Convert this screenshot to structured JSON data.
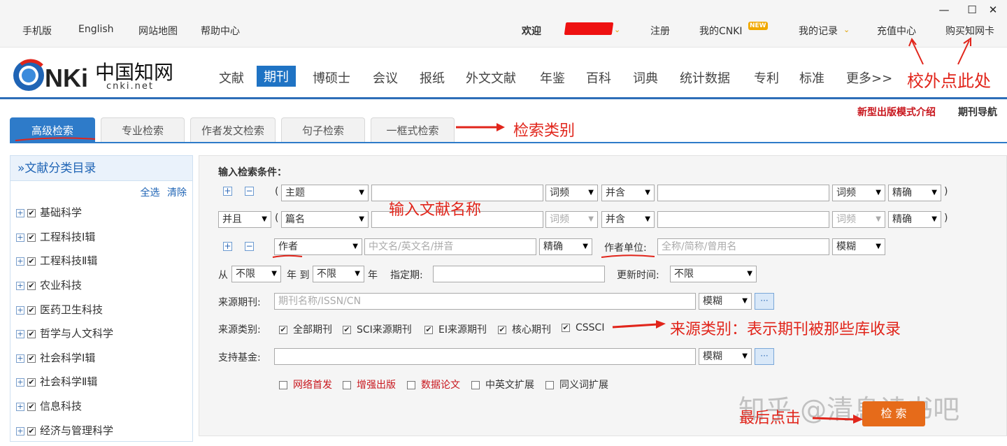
{
  "window": {
    "minimize": "—",
    "maximize": "☐",
    "close": "✕"
  },
  "topbar": {
    "links": [
      "手机版",
      "English",
      "网站地图",
      "帮助中心"
    ],
    "welcome": "欢迎",
    "register": "注册",
    "my_cnki": "我的CNKI",
    "new_badge": "NEW",
    "my_records": "我的记录",
    "recharge": "充值中心",
    "buy_card": "购买知网卡"
  },
  "logo": {
    "text": "CNKI",
    "cn": "中国知网",
    "domain": "cnki.net"
  },
  "nav": [
    "文献",
    "期刊",
    "博硕士",
    "会议",
    "报纸",
    "外文文献",
    "年鉴",
    "百科",
    "词典",
    "统计数据",
    "专利",
    "标准",
    "更多>>"
  ],
  "nav_active": "期刊",
  "right_links": {
    "new_mode": "新型出版模式介绍",
    "journal_nav": "期刊导航"
  },
  "tabs": [
    "高级检索",
    "专业检索",
    "作者发文检索",
    "句子检索",
    "一框式检索"
  ],
  "sidebar": {
    "title": "»文献分类目录",
    "select_all": "全选",
    "clear": "清除",
    "items": [
      "基础科学",
      "工程科技Ⅰ辑",
      "工程科技Ⅱ辑",
      "农业科技",
      "医药卫生科技",
      "哲学与人文科学",
      "社会科学Ⅰ辑",
      "社会科学Ⅱ辑",
      "信息科技",
      "经济与管理科学"
    ]
  },
  "form": {
    "heading": "输入检索条件：",
    "row1": {
      "open": "(",
      "field": "主题",
      "freq": "词频",
      "rel": "并含",
      "freq2": "词频",
      "match": "精确",
      "close": ")"
    },
    "row2": {
      "logic": "并且",
      "open": "(",
      "field": "篇名",
      "freq": "词频",
      "rel": "并含",
      "freq2": "词频",
      "match": "精确",
      "close": ")"
    },
    "row3": {
      "field": "作者",
      "name_placeholder": "中文名/英文名/拼音",
      "match": "精确",
      "affil_label": "作者单位:",
      "affil_placeholder": "全称/简称/曾用名",
      "affil_match": "模糊"
    },
    "date": {
      "from": "从",
      "from_val": "不限",
      "year_to": "年 到",
      "to_val": "不限",
      "year": "年",
      "period_label": "指定期:",
      "update_label": "更新时间:",
      "update_val": "不限"
    },
    "source": {
      "label": "来源期刊:",
      "placeholder": "期刊名称/ISSN/CN",
      "match": "模糊",
      "dots": "···"
    },
    "source_type": {
      "label": "来源类别:",
      "options": [
        "全部期刊",
        "SCI来源期刊",
        "EI来源期刊",
        "核心期刊",
        "CSSCI"
      ]
    },
    "fund": {
      "label": "支持基金:",
      "match": "模糊",
      "dots": "···"
    },
    "extra": [
      "网络首发",
      "增强出版",
      "数据论文",
      "中英文扩展",
      "同义词扩展"
    ],
    "search_button": "检 索"
  },
  "annotations": {
    "school": "校外点此处",
    "search_type": "检索类别",
    "input_title": "输入文献名称",
    "source_type": "来源类别：表示期刊被那些库收录",
    "click_last": "最后点击"
  },
  "watermark": "知乎 @清息读书吧",
  "colors": {
    "accent": "#1f73c4",
    "annotation": "#e1251b",
    "search_btn": "#e66b1a"
  }
}
